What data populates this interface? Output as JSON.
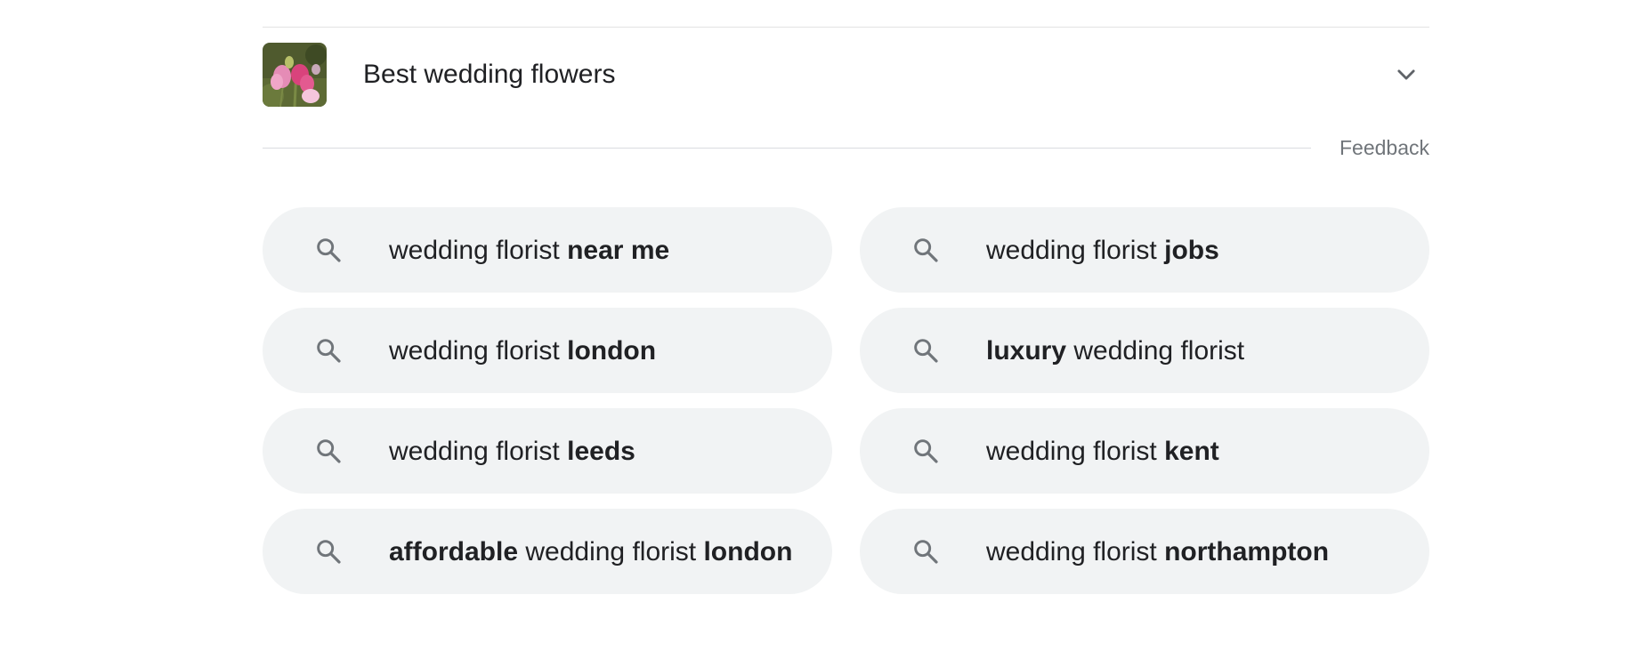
{
  "related_searches_header": {
    "title": "Best wedding flowers"
  },
  "feedback": {
    "label": "Feedback"
  },
  "suggestions": [
    {
      "parts": [
        {
          "text": "wedding florist ",
          "bold": false
        },
        {
          "text": "near me",
          "bold": true
        }
      ]
    },
    {
      "parts": [
        {
          "text": "wedding florist ",
          "bold": false
        },
        {
          "text": "jobs",
          "bold": true
        }
      ]
    },
    {
      "parts": [
        {
          "text": "wedding florist ",
          "bold": false
        },
        {
          "text": "london",
          "bold": true
        }
      ]
    },
    {
      "parts": [
        {
          "text": "luxury",
          "bold": true
        },
        {
          "text": " wedding florist",
          "bold": false
        }
      ]
    },
    {
      "parts": [
        {
          "text": "wedding florist ",
          "bold": false
        },
        {
          "text": "leeds",
          "bold": true
        }
      ]
    },
    {
      "parts": [
        {
          "text": "wedding florist ",
          "bold": false
        },
        {
          "text": "kent",
          "bold": true
        }
      ]
    },
    {
      "parts": [
        {
          "text": "affordable",
          "bold": true
        },
        {
          "text": " wedding florist ",
          "bold": false
        },
        {
          "text": "london",
          "bold": true
        }
      ]
    },
    {
      "parts": [
        {
          "text": "wedding florist ",
          "bold": false
        },
        {
          "text": "northampton",
          "bold": true
        }
      ]
    }
  ],
  "colors": {
    "chip_background": "#f1f3f4",
    "text": "#202124",
    "secondary_text": "#70757a",
    "divider": "#dadce0"
  },
  "icons": {
    "search": "search-icon",
    "expand": "chevron-down-icon",
    "thumbnail": "flower-thumbnail"
  }
}
